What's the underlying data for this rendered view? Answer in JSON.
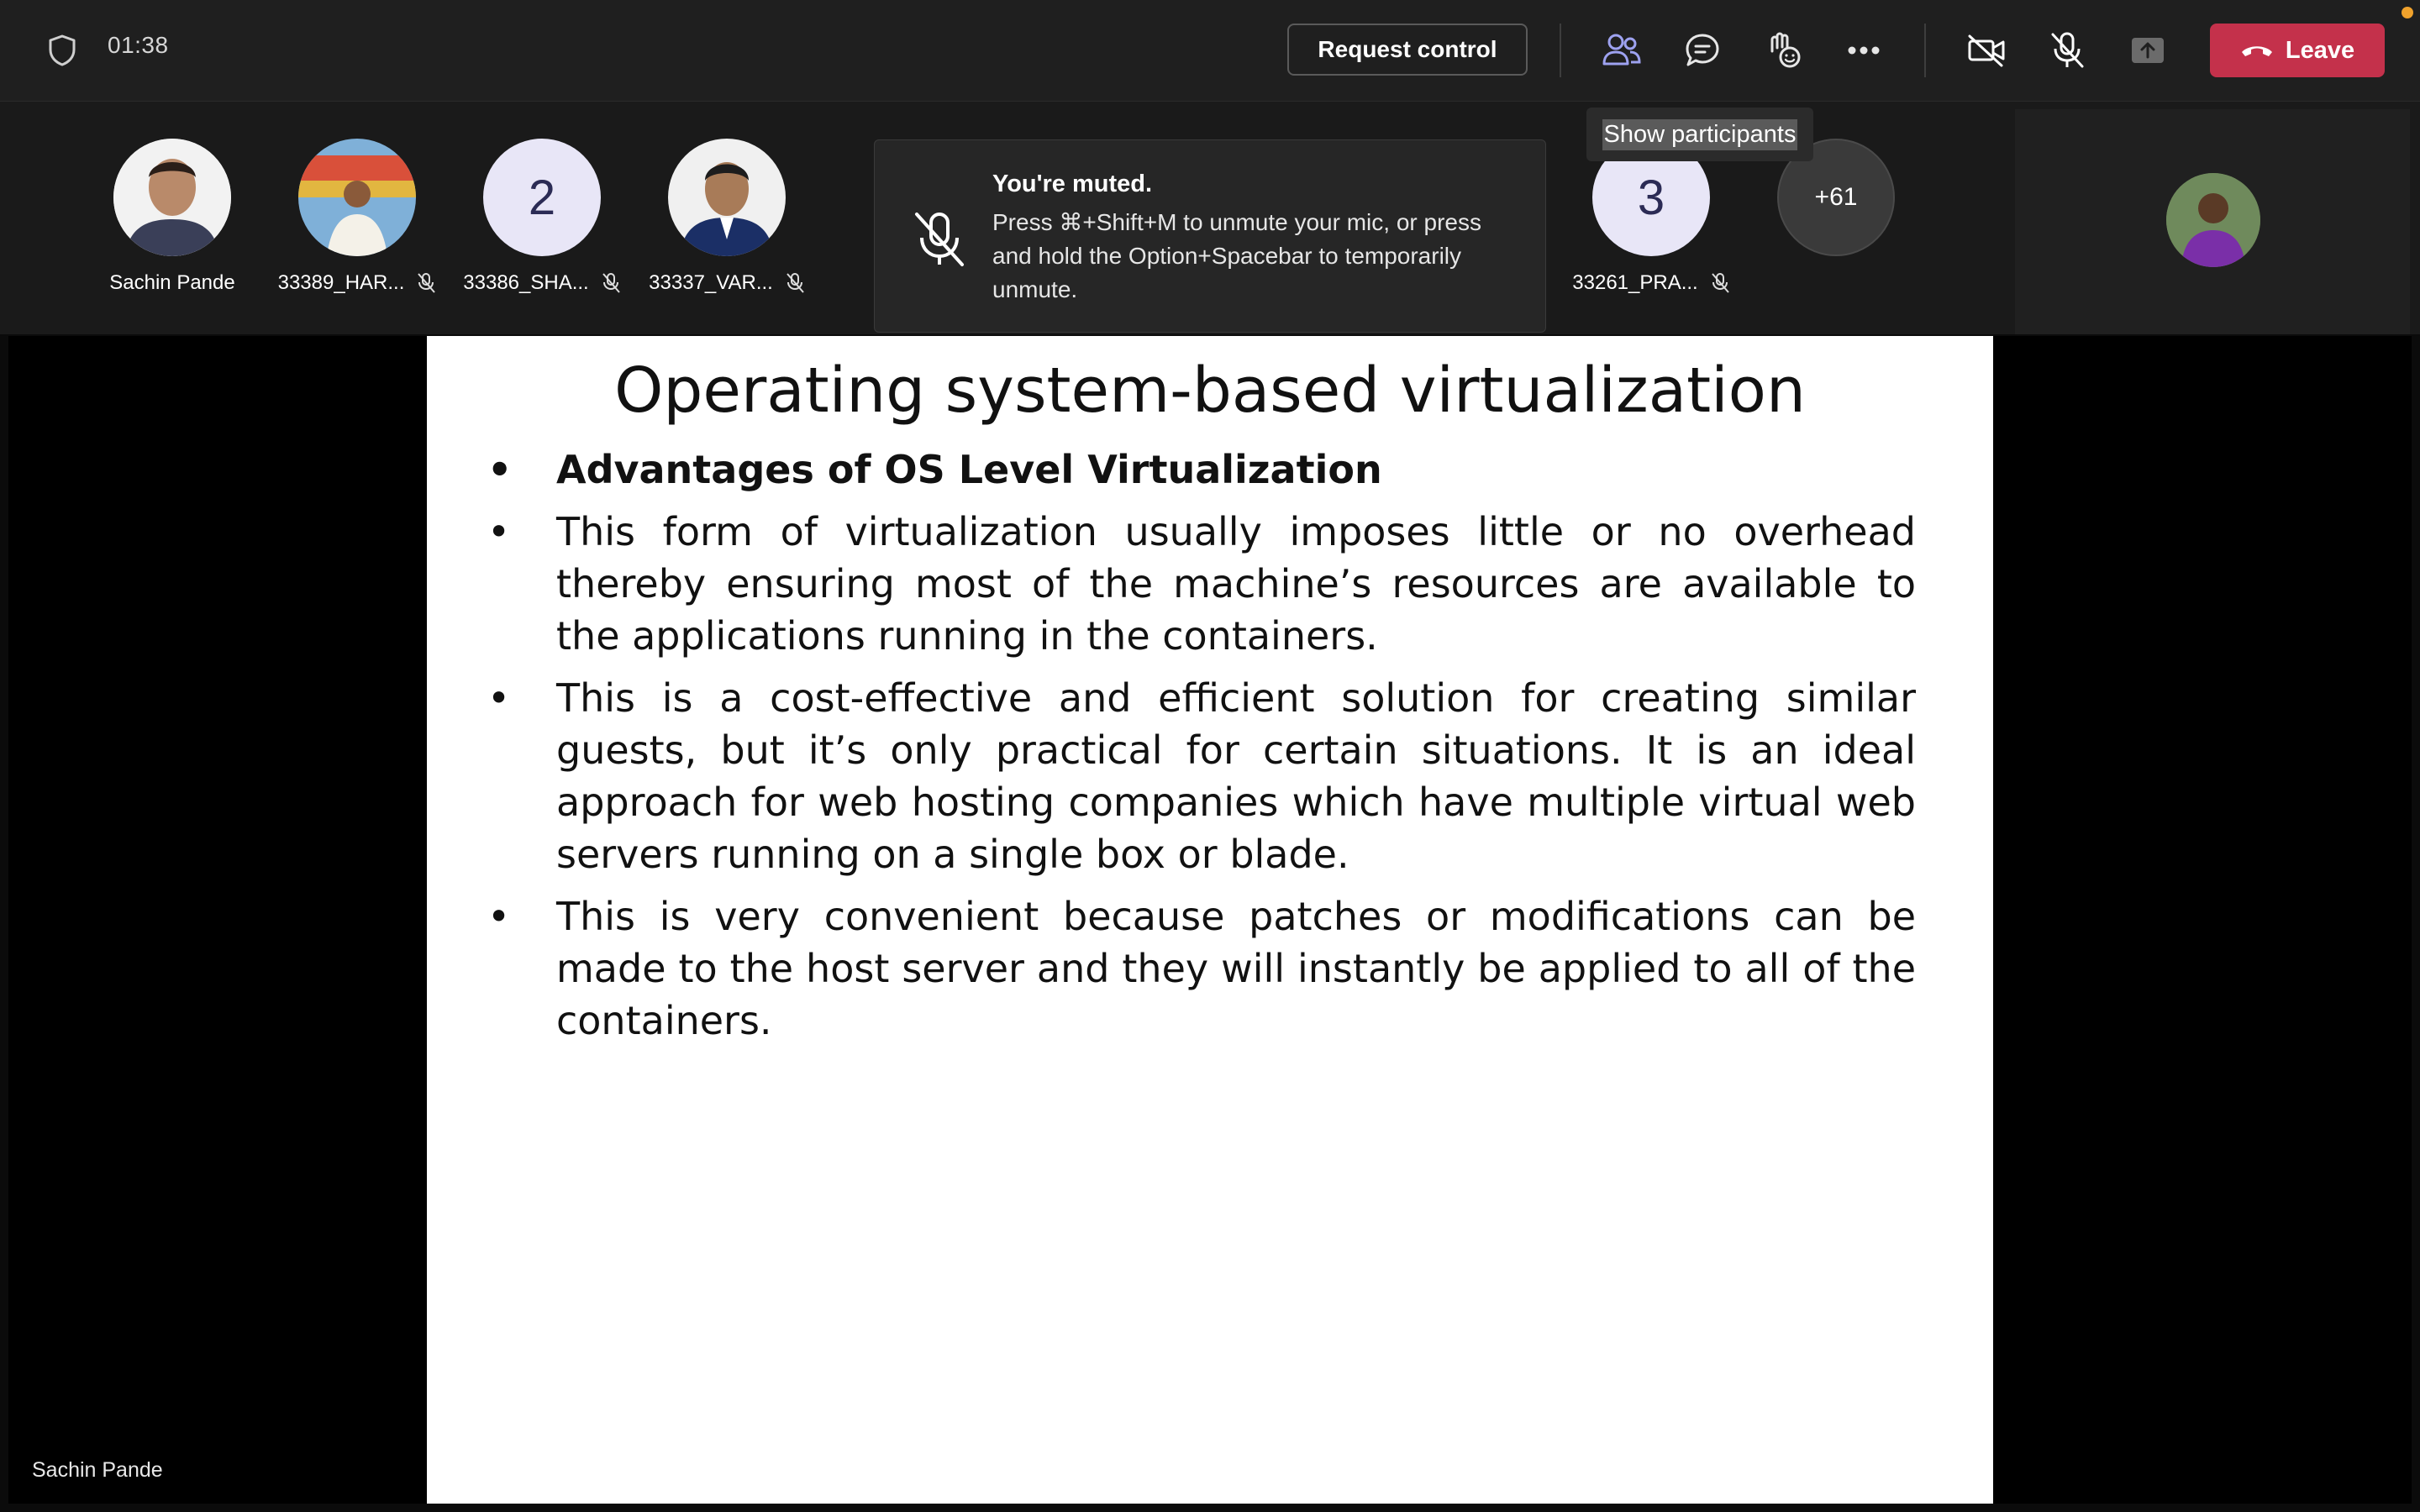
{
  "toolbar": {
    "timer": "01:38",
    "request_control_label": "Request control",
    "leave_label": "Leave",
    "icons": [
      "shield-icon",
      "people-icon",
      "chat-icon",
      "reactions-icon",
      "more-icon",
      "camera-off-icon",
      "mic-off-icon",
      "share-icon",
      "phone-hangup-icon"
    ],
    "leave_color": "#c4314b"
  },
  "tooltip": {
    "text": "Show participants"
  },
  "participants": [
    {
      "name": "Sachin Pande",
      "avatar": "photo",
      "muted": false
    },
    {
      "name": "33389_HAR...",
      "avatar": "photo",
      "muted": true
    },
    {
      "name": "33386_SHA...",
      "avatar": "2",
      "muted": true
    },
    {
      "name": "33337_VAR...",
      "avatar": "photo",
      "muted": true
    },
    {
      "name": "33261_PRA...",
      "avatar": "3",
      "muted": true
    }
  ],
  "overflow_count": "+61",
  "toast": {
    "title": "You're muted.",
    "body": "Press ⌘+Shift+M to unmute your mic, or press and hold the Option+Spacebar to temporarily unmute."
  },
  "slide": {
    "title": "Operating system-based virtualization",
    "heading": "Advantages of OS Level Virtualization",
    "bullets": [
      "This form of virtualization usually imposes little or no overhead thereby ensuring most of the machine’s resources are available to the applications running in the containers.",
      "This is a cost-effective and efficient solution for creating similar guests, but it’s only practical for certain situations. It is an ideal approach for web hosting companies which have multiple virtual web servers running on a single box or blade.",
      "This is very convenient because patches or modifications can be made to the host server and they will instantly be applied to all of the containers."
    ]
  },
  "stage": {
    "speaker_name": "Sachin Pande"
  }
}
